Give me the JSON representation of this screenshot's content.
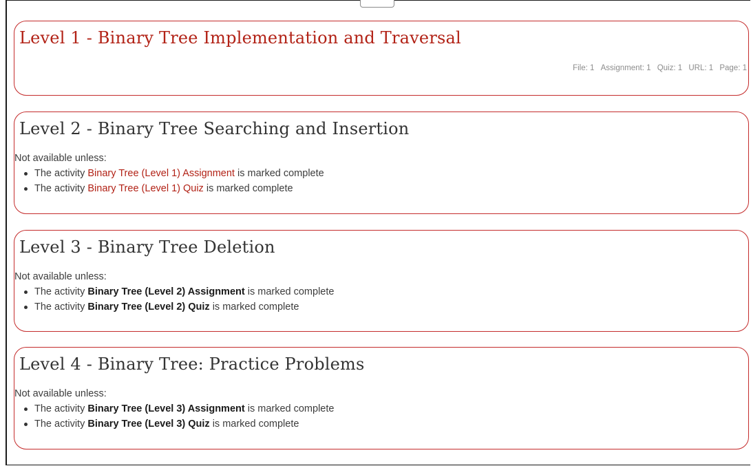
{
  "sections": [
    {
      "title": "Level 1 - Binary Tree Implementation and Traversal",
      "summary": [
        "File: 1",
        "Assignment: 1",
        "Quiz: 1",
        "URL: 1",
        "Page: 1"
      ]
    },
    {
      "title": "Level 2 - Binary Tree Searching and Insertion",
      "restriction_intro": "Not available unless:",
      "conditions": [
        {
          "prefix": "The activity",
          "activity": "Binary Tree (Level 1) Assignment",
          "suffix": "is marked complete"
        },
        {
          "prefix": "The activity",
          "activity": "Binary Tree (Level 1) Quiz",
          "suffix": "is marked complete"
        }
      ]
    },
    {
      "title": "Level 3 - Binary Tree Deletion",
      "restriction_intro": "Not available unless:",
      "conditions": [
        {
          "prefix": "The activity",
          "activity": "Binary Tree (Level 2) Assignment",
          "suffix": "is marked complete"
        },
        {
          "prefix": "The activity",
          "activity": "Binary Tree (Level 2) Quiz",
          "suffix": "is marked complete"
        }
      ]
    },
    {
      "title": "Level 4 - Binary Tree: Practice Problems",
      "restriction_intro": "Not available unless:",
      "conditions": [
        {
          "prefix": "The activity",
          "activity": "Binary Tree (Level 3) Assignment",
          "suffix": "is marked complete"
        },
        {
          "prefix": "The activity",
          "activity": "Binary Tree (Level 3) Quiz",
          "suffix": "is marked complete"
        }
      ]
    }
  ],
  "colors": {
    "accent": "#b22216",
    "border": "#c42b2b",
    "muted": "#8c8c8c"
  }
}
